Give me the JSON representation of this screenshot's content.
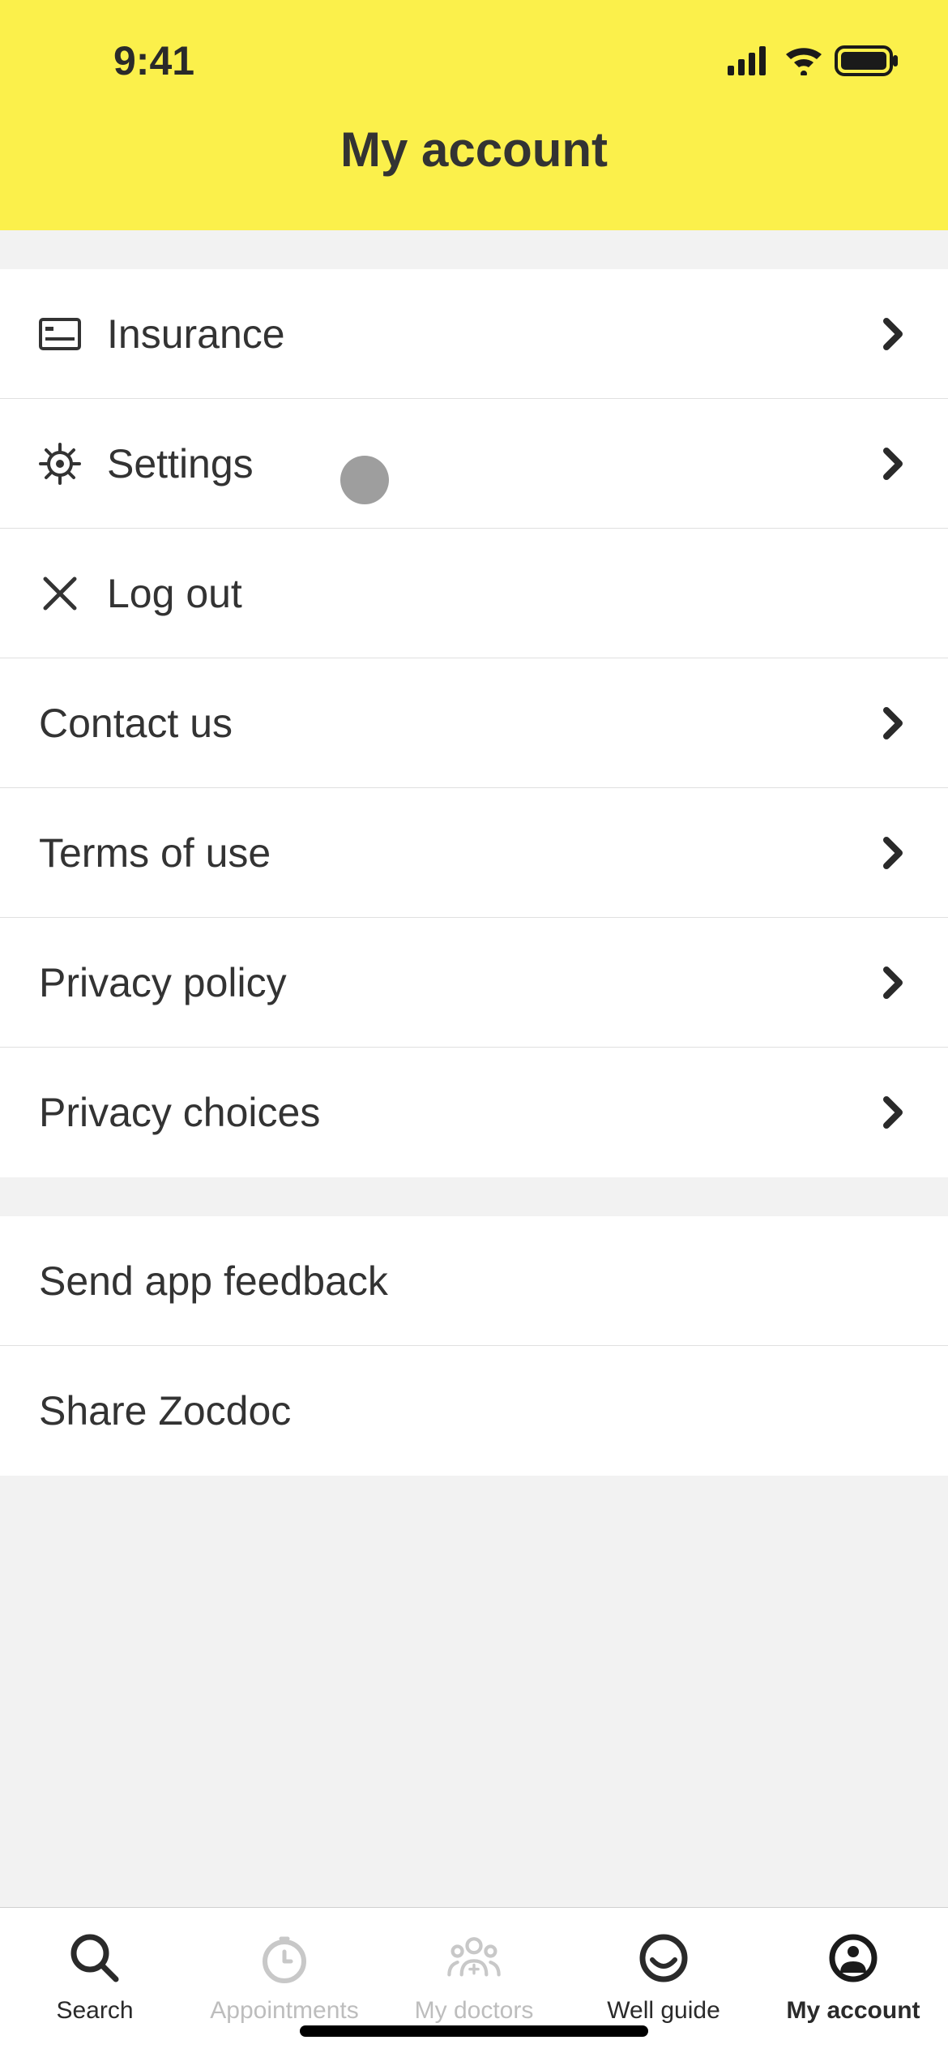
{
  "statusBar": {
    "time": "9:41"
  },
  "header": {
    "title": "My account"
  },
  "section1": {
    "items": [
      {
        "icon": "insurance-card",
        "label": "Insurance",
        "hasChevron": true
      },
      {
        "icon": "gear",
        "label": "Settings",
        "hasChevron": true
      },
      {
        "icon": "close",
        "label": "Log out",
        "hasChevron": false
      }
    ]
  },
  "section2": {
    "items": [
      {
        "label": "Contact us",
        "hasChevron": true
      },
      {
        "label": "Terms of use",
        "hasChevron": true
      },
      {
        "label": "Privacy policy",
        "hasChevron": true
      },
      {
        "label": "Privacy choices",
        "hasChevron": true
      }
    ]
  },
  "section3": {
    "items": [
      {
        "label": "Send app feedback",
        "hasChevron": false
      },
      {
        "label": "Share Zocdoc",
        "hasChevron": false
      }
    ]
  },
  "tabBar": {
    "items": [
      {
        "icon": "search",
        "label": "Search",
        "active": false
      },
      {
        "icon": "clock",
        "label": "Appointments",
        "active": false
      },
      {
        "icon": "doctors",
        "label": "My doctors",
        "active": false
      },
      {
        "icon": "smile",
        "label": "Well guide",
        "active": false
      },
      {
        "icon": "account",
        "label": "My account",
        "active": true
      }
    ]
  }
}
